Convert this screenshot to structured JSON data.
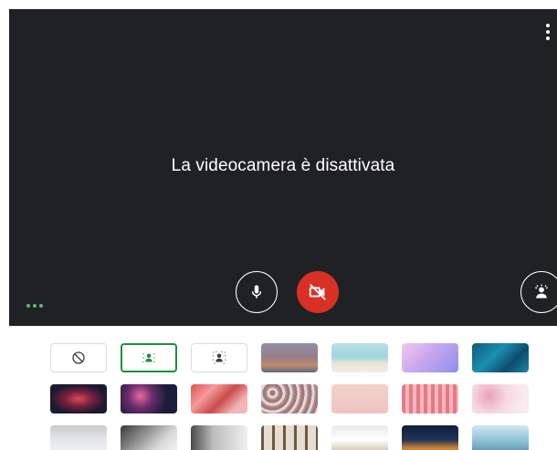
{
  "preview": {
    "camera_off_text": "La videocamera è disattivata",
    "more_options_icon": "more-vert-icon",
    "mic_icon": "microphone-icon",
    "camera_icon": "camera-off-icon",
    "effects_icon": "visual-effects-icon",
    "camera_button_color": "#d93025"
  },
  "backgrounds": {
    "options": [
      {
        "name": "no-effect",
        "icon": "block-icon"
      },
      {
        "name": "slight-blur",
        "icon": "blur-person-icon",
        "selected": true
      },
      {
        "name": "blur",
        "icon": "blur-strong-icon"
      }
    ],
    "images": [
      "sunset",
      "beach",
      "purple-sky",
      "ocean",
      "nebula",
      "fireworks",
      "flowers",
      "pebbles",
      "pink-paper",
      "pink-pattern",
      "blossom",
      "room-white",
      "room-loft",
      "room-gallery",
      "bookshelf",
      "lounge",
      "house-night",
      "coast"
    ]
  }
}
